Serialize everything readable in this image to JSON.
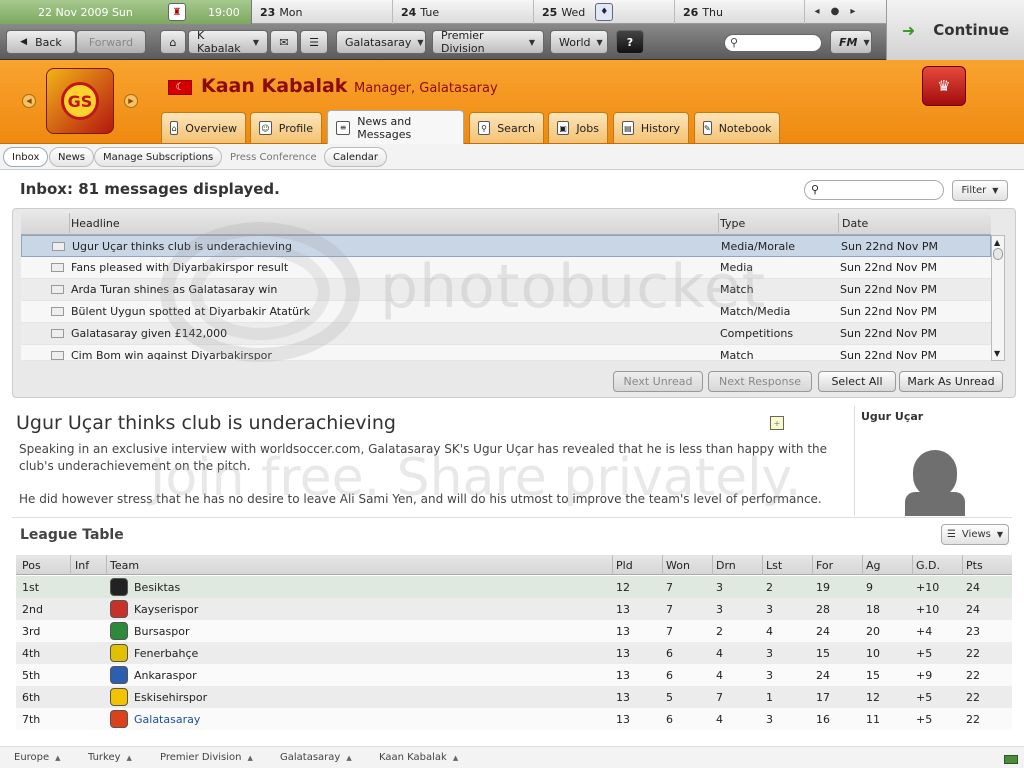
{
  "calendar": {
    "today_dow": "22",
    "today_date": "22 Nov 2009  Sun",
    "today_time": "19:00",
    "days": [
      {
        "num": "23",
        "name": "Mon"
      },
      {
        "num": "24",
        "name": "Tue"
      },
      {
        "num": "25",
        "name": "Wed"
      },
      {
        "num": "26",
        "name": "Thu"
      }
    ]
  },
  "continue_label": "Continue",
  "toolbar": {
    "back": "Back",
    "forward": "Forward",
    "manager": "K Kabalak",
    "club": "Galatasaray",
    "competition": "Premier Division",
    "world": "World",
    "help": "?",
    "fm": "FM"
  },
  "header": {
    "manager_name": "Kaan Kabalak",
    "manager_role": "Manager, Galatasaray",
    "flag_colors": {
      "bg": "#d40000"
    },
    "tabs": [
      "Overview",
      "Profile",
      "News and Messages",
      "Search",
      "Jobs",
      "History",
      "Notebook"
    ]
  },
  "subtabs": [
    "Inbox",
    "News",
    "Manage Subscriptions",
    "Press Conference",
    "Calendar"
  ],
  "inbox": {
    "title": "Inbox: 81 messages displayed.",
    "filter": "Filter",
    "columns": {
      "headline": "Headline",
      "type": "Type",
      "date": "Date"
    },
    "messages": [
      {
        "headline": "Ugur Uçar thinks club is underachieving",
        "type": "Media/Morale",
        "date": "Sun 22nd Nov PM"
      },
      {
        "headline": "Fans pleased with Diyarbakirspor result",
        "type": "Media",
        "date": "Sun 22nd Nov PM"
      },
      {
        "headline": "Arda Turan shines as Galatasaray win",
        "type": "Match",
        "date": "Sun 22nd Nov PM"
      },
      {
        "headline": "Bülent Uygun spotted at Diyarbakir Atatürk",
        "type": "Match/Media",
        "date": "Sun 22nd Nov PM"
      },
      {
        "headline": "Galatasaray given £142,000",
        "type": "Competitions",
        "date": "Sun 22nd Nov PM"
      },
      {
        "headline": "Cim Bom win against Diyarbakirspor",
        "type": "Match",
        "date": "Sun 22nd Nov PM"
      }
    ],
    "buttons": {
      "next_unread": "Next Unread",
      "next_response": "Next Response",
      "select_all": "Select All",
      "mark_unread": "Mark As Unread"
    }
  },
  "article": {
    "title": "Ugur Uçar thinks club is underachieving",
    "p1": "Speaking in an exclusive interview with worldsoccer.com, Galatasaray SK's Ugur Uçar has revealed that he is less than happy with the club's underachievement on the pitch.",
    "p2": "He did however stress that he has no desire to leave Ali Sami Yen, and will do his utmost to improve the team's level of performance.",
    "player": "Ugur Uçar"
  },
  "league": {
    "title": "League Table",
    "views": "Views",
    "columns": [
      "Pos",
      "Inf",
      "Team",
      "Pld",
      "Won",
      "Drn",
      "Lst",
      "For",
      "Ag",
      "G.D.",
      "Pts"
    ],
    "rows": [
      {
        "pos": "1st",
        "team": "Besiktas",
        "pld": "12",
        "won": "7",
        "drn": "3",
        "lst": "2",
        "for": "19",
        "ag": "9",
        "gd": "+10",
        "pts": "24",
        "color": "#222222"
      },
      {
        "pos": "2nd",
        "team": "Kayserispor",
        "pld": "13",
        "won": "7",
        "drn": "3",
        "lst": "3",
        "for": "28",
        "ag": "18",
        "gd": "+10",
        "pts": "24",
        "color": "#c8302a"
      },
      {
        "pos": "3rd",
        "team": "Bursaspor",
        "pld": "13",
        "won": "7",
        "drn": "2",
        "lst": "4",
        "for": "24",
        "ag": "20",
        "gd": "+4",
        "pts": "23",
        "color": "#2e8a3a"
      },
      {
        "pos": "4th",
        "team": "Fenerbahçe",
        "pld": "13",
        "won": "6",
        "drn": "4",
        "lst": "3",
        "for": "15",
        "ag": "10",
        "gd": "+5",
        "pts": "22",
        "color": "#e0c000"
      },
      {
        "pos": "5th",
        "team": "Ankaraspor",
        "pld": "13",
        "won": "6",
        "drn": "4",
        "lst": "3",
        "for": "24",
        "ag": "15",
        "gd": "+9",
        "pts": "22",
        "color": "#2b5fb0"
      },
      {
        "pos": "6th",
        "team": "Eskisehirspor",
        "pld": "13",
        "won": "5",
        "drn": "7",
        "lst": "1",
        "for": "17",
        "ag": "12",
        "gd": "+5",
        "pts": "22",
        "color": "#f2c400"
      },
      {
        "pos": "7th",
        "team": "Galatasaray",
        "pld": "13",
        "won": "6",
        "drn": "4",
        "lst": "3",
        "for": "16",
        "ag": "11",
        "gd": "+5",
        "pts": "22",
        "color": "#d9421a"
      }
    ]
  },
  "footer": [
    "Europe",
    "Turkey",
    "Premier Division",
    "Galatasaray",
    "Kaan Kabalak"
  ],
  "watermark": {
    "line1": "photobucket",
    "line2": "Join free. Share privately."
  }
}
